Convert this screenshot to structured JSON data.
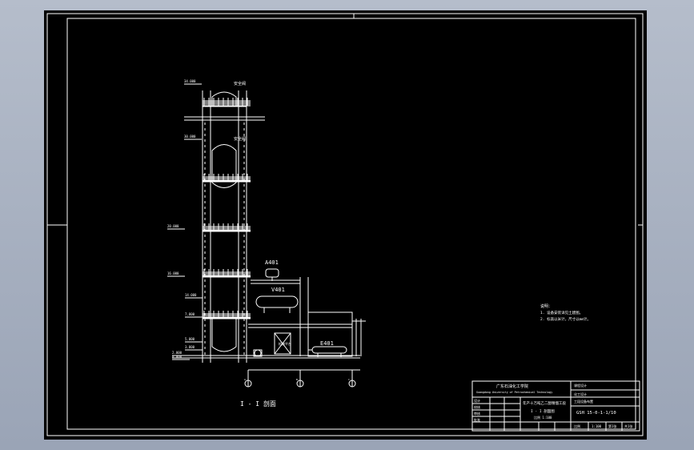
{
  "drawing": {
    "section_title": "I - I 剖面",
    "equipment": {
      "accumulator": "A401",
      "vessel": "V401",
      "exchanger": "E401",
      "platform_note": "检修平台"
    },
    "elevations": [
      "34.000",
      "30.000",
      "20.000",
      "16.000",
      "14.000",
      "7.800",
      "5.000",
      "3.800",
      "2.000",
      "0.000"
    ],
    "top_labels": [
      "安全阀",
      "安全阀"
    ],
    "grid_labels": [
      "A",
      "B",
      "C"
    ],
    "notes": {
      "heading": "说明：",
      "lines": [
        "1. 设备安装详见土建图。",
        "2. 标高以米计，尺寸以mm计。"
      ]
    }
  },
  "title_block": {
    "school": "广东石油化工学院",
    "school_en": "Guangdong University of Petrochemical Technology",
    "design_title": "年产十万吨乙二醇精馏工段",
    "drawing_name": "I - I 剖面图",
    "scale": "比例 1:100",
    "drawing_no": "GSH 15-0-1-1/10",
    "roles": [
      "设计",
      "校核",
      "审核",
      "批准"
    ],
    "project": [
      "课程设计",
      "化工设计",
      "工段设备布置"
    ],
    "footer": [
      "比例",
      "1:100",
      "第1张",
      "共1张"
    ]
  }
}
